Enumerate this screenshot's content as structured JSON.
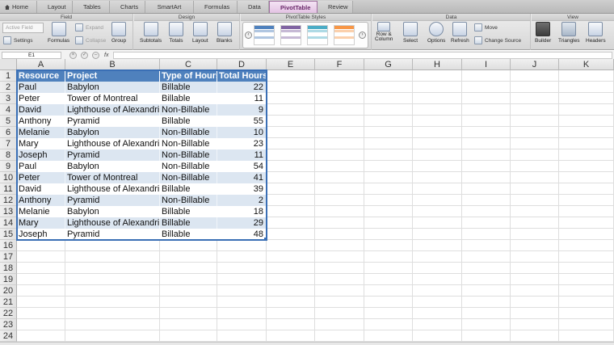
{
  "ribbon": {
    "tabs": [
      "Home",
      "Layout",
      "Tables",
      "Charts",
      "SmartArt",
      "Formulas",
      "Data",
      "PivotTable",
      "Review"
    ],
    "active_tab": "PivotTable",
    "groups": {
      "field": "Field",
      "design": "Design",
      "styles": "PivotTable Styles",
      "data": "Data",
      "view": "View"
    },
    "field": {
      "active_field_placeholder": "Active Field",
      "settings": "Settings",
      "formulas": "Formulas",
      "expand": "Expand",
      "collapse": "Collapse",
      "group": "Group"
    },
    "design": {
      "subtotals": "Subtotals",
      "totals": "Totals",
      "layout": "Layout",
      "blanks": "Blanks"
    },
    "data": {
      "row_column": "Row &",
      "row_column_2": "Column",
      "select": "Select",
      "options": "Options",
      "refresh": "Refresh",
      "move": "Move",
      "change_source": "Change Source"
    },
    "view": {
      "builder": "Builder",
      "triangles": "Triangles",
      "headers": "Headers"
    },
    "style_colors": [
      "#4f81bd",
      "#8064a2",
      "#4bacc6",
      "#f79646"
    ]
  },
  "formula_bar": {
    "name_box": "E1",
    "fx": "fx",
    "formula": ""
  },
  "columns": [
    "A",
    "B",
    "C",
    "D",
    "E",
    "F",
    "G",
    "H",
    "I",
    "J",
    "K"
  ],
  "rows": [
    "1",
    "2",
    "3",
    "4",
    "5",
    "6",
    "7",
    "8",
    "9",
    "10",
    "11",
    "12",
    "13",
    "14",
    "15",
    "16",
    "17",
    "18",
    "19",
    "20",
    "21",
    "22",
    "23",
    "24"
  ],
  "table": {
    "headers": [
      "Resource",
      "Project",
      "Type of Hours",
      "Total Hours"
    ],
    "rows": [
      [
        "Paul",
        "Babylon",
        "Billable",
        "22"
      ],
      [
        "Peter",
        "Tower of Montreal",
        "Billable",
        "11"
      ],
      [
        "David",
        "Lighthouse of Alexandria",
        "Non-Billable",
        "9"
      ],
      [
        "Anthony",
        "Pyramid",
        "Billable",
        "55"
      ],
      [
        "Melanie",
        "Babylon",
        "Non-Billable",
        "10"
      ],
      [
        "Mary",
        "Lighthouse of Alexandria",
        "Non-Billable",
        "23"
      ],
      [
        "Joseph",
        "Pyramid",
        "Non-Billable",
        "11"
      ],
      [
        "Paul",
        "Babylon",
        "Non-Billable",
        "54"
      ],
      [
        "Peter",
        "Tower of Montreal",
        "Non-Billable",
        "41"
      ],
      [
        "David",
        "Lighthouse of Alexandria",
        "Billable",
        "39"
      ],
      [
        "Anthony",
        "Pyramid",
        "Non-Billable",
        "2"
      ],
      [
        "Melanie",
        "Babylon",
        "Billable",
        "18"
      ],
      [
        "Mary",
        "Lighthouse of Alexandria",
        "Billable",
        "29"
      ],
      [
        "Joseph",
        "Pyramid",
        "Billable",
        "48"
      ]
    ]
  },
  "colors": {
    "header_fill": "#4f81bd",
    "band_fill": "#dce6f1",
    "selection": "#3a6fb5",
    "active_tab": "#e3c3e3"
  }
}
